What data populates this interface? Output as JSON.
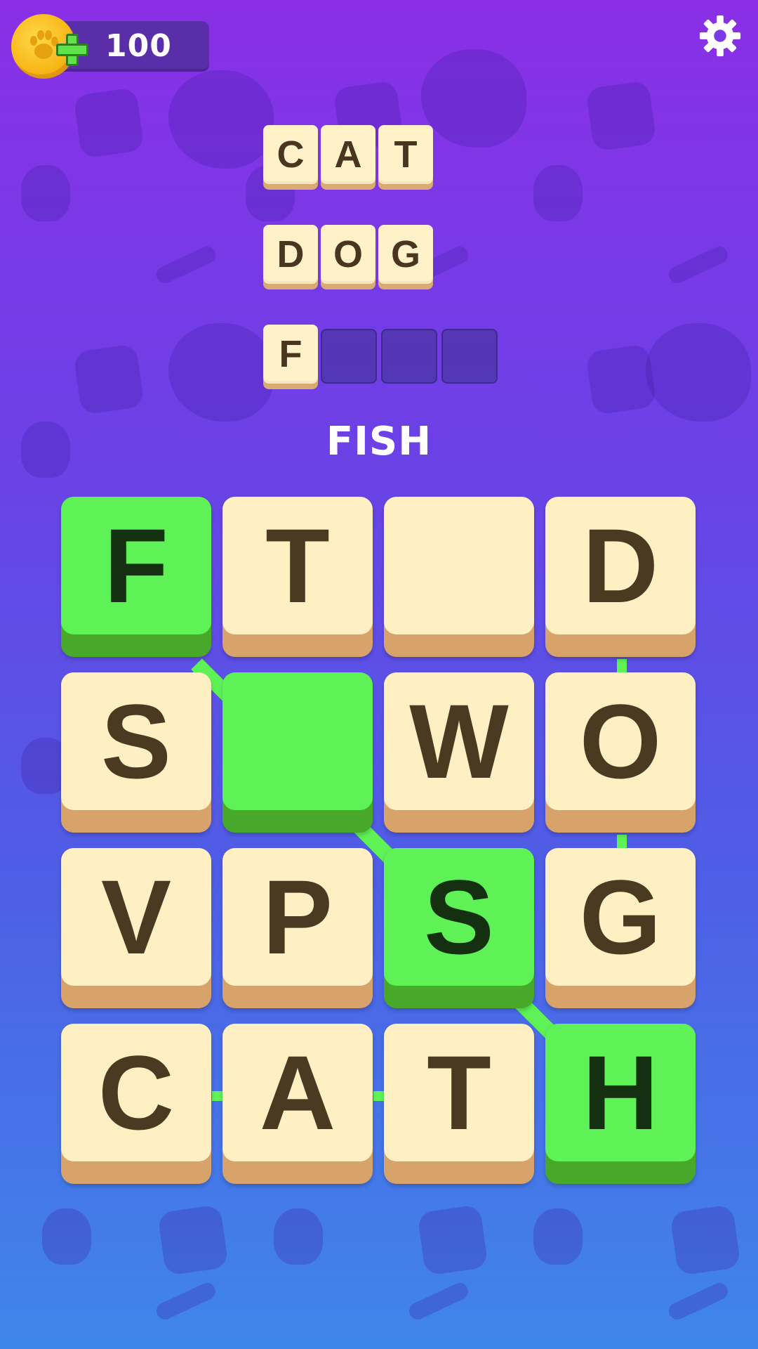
{
  "header": {
    "coins": "100",
    "coin_icon": "paw-coin-icon",
    "add_icon": "plus-icon",
    "settings_icon": "gear-icon"
  },
  "answers": [
    {
      "letters": [
        "C",
        "A",
        "T"
      ],
      "empty": 0
    },
    {
      "letters": [
        "D",
        "O",
        "G"
      ],
      "empty": 0
    },
    {
      "letters": [
        "F"
      ],
      "empty": 3
    }
  ],
  "current_word": "FISH",
  "grid": [
    {
      "letter": "F",
      "selected": true
    },
    {
      "letter": "T",
      "selected": false
    },
    {
      "letter": "",
      "selected": false
    },
    {
      "letter": "D",
      "selected": false
    },
    {
      "letter": "S",
      "selected": false
    },
    {
      "letter": "",
      "selected": true
    },
    {
      "letter": "W",
      "selected": false
    },
    {
      "letter": "O",
      "selected": false
    },
    {
      "letter": "V",
      "selected": false
    },
    {
      "letter": "P",
      "selected": false
    },
    {
      "letter": "S",
      "selected": true
    },
    {
      "letter": "G",
      "selected": false
    },
    {
      "letter": "C",
      "selected": false
    },
    {
      "letter": "A",
      "selected": false
    },
    {
      "letter": "T",
      "selected": false
    },
    {
      "letter": "H",
      "selected": true
    }
  ],
  "colors": {
    "tile": "#fff0c4",
    "tile_selected": "#5ef256",
    "link": "#5ef256"
  }
}
